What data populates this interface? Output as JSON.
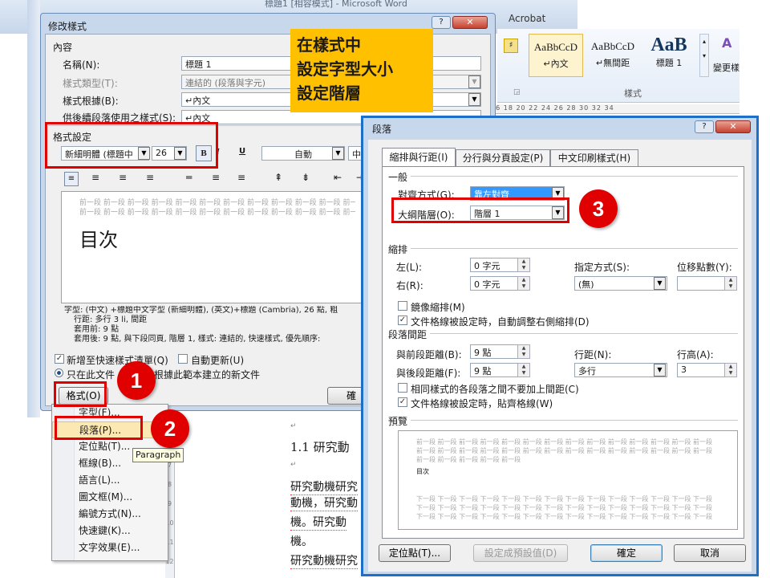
{
  "word_titlebar": {
    "title": "標題1 [相容模式] - Microsoft Word",
    "acrobat": "Acrobat"
  },
  "ribbon": {
    "styles": [
      {
        "preview": "AaBbCcD",
        "name": "↵內文"
      },
      {
        "preview": "AaBbCcD",
        "name": "↵無間距"
      },
      {
        "preview": "AaB",
        "name": "標題 1"
      }
    ],
    "group_label": "樣式",
    "change_styles": "變更樣",
    "ruler": "16 18 20 22 24 26 28 30 32 34"
  },
  "callout": {
    "line1": "在樣式中",
    "line2": "設定字型大小",
    "line3": "設定階層"
  },
  "modify_dialog": {
    "title": "修改樣式",
    "section_properties": "內容",
    "name_label": "名稱(N):",
    "name_value": "標題 1",
    "type_label": "樣式類型(T):",
    "type_value": "連結的 (段落與字元)",
    "based_label": "樣式根據(B):",
    "based_value": "↵內文",
    "following_label": "供後續段落使用之樣式(S):",
    "following_value": "↵內文",
    "section_format": "格式設定",
    "font_name": "新細明體 (標題中",
    "font_size": "26",
    "bold": "B",
    "italic": "I",
    "underline": "U",
    "color": "自動",
    "lang": "中",
    "preview_prev": [
      "前一段 前一段 前一段 前一段 前一段 前一段 前一段 前一段 前一段 前一段 前一段 前一段",
      "前一段 前一段 前一段 前一段 前一段 前一段 前一段 前一段 前一段 前一段 前一段 前一段"
    ],
    "preview_main": "目次",
    "description": [
      "字型: (中文) +標題中文字型 (新細明體), (英文)+標題 (Cambria), 26 點, 粗",
      "行距: 多行 3 li, 間距",
      "套用前: 9 點",
      "套用後: 9 點, 與下段同頁, 階層 1, 樣式: 連結的, 快速樣式, 優先順序:"
    ],
    "add_quick": "新增至快速樣式清單(Q)",
    "auto_update": "自動更新(U)",
    "only_doc": "只在此文件",
    "new_docs": "根據此範本建立的新文件",
    "format_btn": "格式(O)",
    "ok_btn": "確"
  },
  "format_menu": {
    "items": [
      "字型(F)...",
      "段落(P)...",
      "定位點(T)...",
      "框線(B)...",
      "語言(L)...",
      "圖文框(M)...",
      "編號方式(N)...",
      "快速鍵(K)...",
      "文字效果(E)..."
    ],
    "tooltip": "Paragraph"
  },
  "document": {
    "heading": "1.1 研究動",
    "line1": "研究動機研究",
    "line2": "動機，研究動",
    "line3": "機。研究動",
    "line4": "機。",
    "line5": "研究動機研究"
  },
  "paragraph_dialog": {
    "title": "段落",
    "tabs": [
      "縮排與行距(I)",
      "分行與分頁設定(P)",
      "中文印刷樣式(H)"
    ],
    "general": "一般",
    "alignment_label": "對齊方式(G):",
    "alignment_value": "靠左對齊",
    "outline_label": "大綱階層(O):",
    "outline_value": "階層 1",
    "indent": "縮排",
    "left_label": "左(L):",
    "left_value": "0 字元",
    "right_label": "右(R):",
    "right_value": "0 字元",
    "special_label": "指定方式(S):",
    "special_value": "(無)",
    "by_label": "位移點數(Y):",
    "by_value": "",
    "mirror": "鏡像縮排(M)",
    "auto_right": "文件格線被設定時，自動調整右側縮排(D)",
    "spacing": "段落間距",
    "before_label": "與前段距離(B):",
    "before_value": "9 點",
    "after_label": "與後段距離(F):",
    "after_value": "9 點",
    "line_label": "行距(N):",
    "line_value": "多行",
    "at_label": "行高(A):",
    "at_value": "3",
    "no_space": "相同樣式的各段落之間不要加上間距(C)",
    "snap_grid": "文件格線被設定時，貼齊格線(W)",
    "preview": "預覽",
    "preview_prev": [
      "前一段 前一段 前一段 前一段 前一段 前一段 前一段 前一段 前一段 前一段 前一段 前一段 前一段 前一段",
      "前一段 前一段 前一段 前一段 前一段 前一段 前一段 前一段 前一段 前一段 前一段 前一段 前一段 前一段",
      "前一段 前一段 前一段 前一段 前一段"
    ],
    "preview_main": "目次",
    "preview_next": [
      "下一段 下一段 下一段 下一段 下一段 下一段 下一段 下一段 下一段 下一段 下一段 下一段 下一段 下一段",
      "下一段 下一段 下一段 下一段 下一段 下一段 下一段 下一段 下一段 下一段 下一段 下一段 下一段 下一段",
      "下一段 下一段 下一段 下一段 下一段 下一段 下一段 下一段 下一段 下一段 下一段 下一段 下一段 下一段"
    ],
    "tabs_btn": "定位點(T)...",
    "default_btn": "設定成預設值(D)",
    "ok_btn": "確定",
    "cancel_btn": "取消"
  },
  "badges": {
    "b1": "1",
    "b2": "2",
    "b3": "3"
  },
  "colors": {
    "highlight": "#e00000",
    "callout": "#ffc000",
    "dialog_border": "#1e6fc7"
  }
}
